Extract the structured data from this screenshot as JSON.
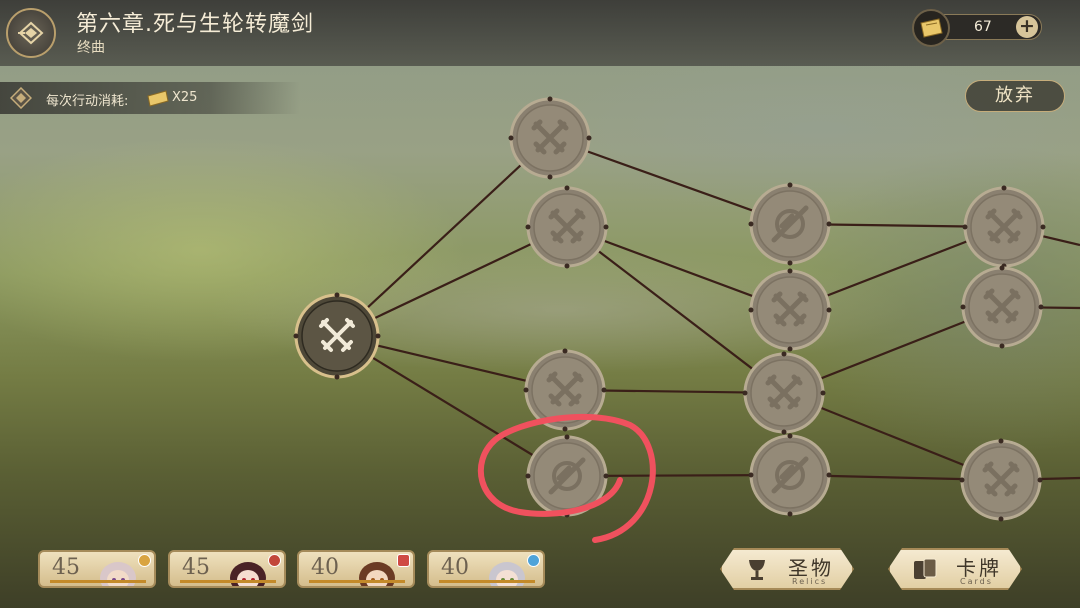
{
  "header": {
    "chapter_title": "第六章.死与生轮转魔剑",
    "subtitle": "终曲",
    "currency_count": "67"
  },
  "cost_bar": {
    "label": "每次行动消耗:",
    "multiplier": "X25"
  },
  "abandon_label": "放弃",
  "map": {
    "nodes": [
      {
        "id": "start",
        "type": "battle",
        "state": "current"
      },
      {
        "id": "c2a",
        "type": "battle",
        "state": "locked"
      },
      {
        "id": "c2b",
        "type": "battle",
        "state": "locked"
      },
      {
        "id": "c2c",
        "type": "battle",
        "state": "locked"
      },
      {
        "id": "c2d",
        "type": "event",
        "state": "locked",
        "highlighted": true
      },
      {
        "id": "c3a",
        "type": "event",
        "state": "locked"
      },
      {
        "id": "c3b",
        "type": "battle",
        "state": "locked"
      },
      {
        "id": "c3c",
        "type": "battle",
        "state": "locked"
      },
      {
        "id": "c3d",
        "type": "event",
        "state": "locked"
      },
      {
        "id": "c4a",
        "type": "battle",
        "state": "locked"
      },
      {
        "id": "c4b",
        "type": "battle",
        "state": "locked"
      },
      {
        "id": "c4c",
        "type": "battle",
        "state": "locked"
      }
    ],
    "edges": [
      [
        "start",
        "c2a"
      ],
      [
        "start",
        "c2b"
      ],
      [
        "start",
        "c2c"
      ],
      [
        "start",
        "c2d"
      ],
      [
        "c2a",
        "c3a"
      ],
      [
        "c2b",
        "c3b"
      ],
      [
        "c2b",
        "c3c"
      ],
      [
        "c2c",
        "c3c"
      ],
      [
        "c2d",
        "c3d"
      ],
      [
        "c3a",
        "c4a"
      ],
      [
        "c3b",
        "c4a"
      ],
      [
        "c3c",
        "c4b"
      ],
      [
        "c3c",
        "c4c"
      ],
      [
        "c3d",
        "c4c"
      ]
    ]
  },
  "party": [
    {
      "level": "45",
      "badge_color": "#d9a441",
      "badge": "x"
    },
    {
      "level": "45",
      "badge_color": "#c2473b",
      "badge": "x"
    },
    {
      "level": "40",
      "badge_color": "#cf4a44",
      "badge": "square"
    },
    {
      "level": "40",
      "badge_color": "#4fa3d9",
      "badge": "dot"
    }
  ],
  "buttons": {
    "relics_label": "圣物",
    "relics_sub": "Relics",
    "cards_label": "卡牌",
    "cards_sub": "Cards"
  },
  "colors": {
    "highlight_circle": "#f0515e",
    "gold_accent": "#c6ad7b"
  }
}
